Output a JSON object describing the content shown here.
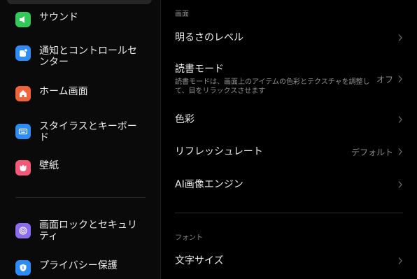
{
  "sidebar": {
    "items": [
      {
        "label": "サウンド",
        "icon": "sound-icon",
        "color": "#34c759"
      },
      {
        "label": "通知とコントロールセンター",
        "icon": "notification-icon",
        "color": "#2f8bf5"
      },
      {
        "label": "ホーム画面",
        "icon": "home-icon",
        "color": "#f0643c"
      },
      {
        "label": "スタイラスとキーボード",
        "icon": "keyboard-icon",
        "color": "#2f8bf5"
      },
      {
        "label": "壁紙",
        "icon": "wallpaper-icon",
        "color": "#f05a78"
      },
      {
        "label": "画面ロックとセキュリティ",
        "icon": "fingerprint-icon",
        "color": "#8a6cf0"
      },
      {
        "label": "プライバシー保護",
        "icon": "privacy-icon",
        "color": "#2f8bf5"
      }
    ]
  },
  "main": {
    "sections": {
      "display": "画面",
      "font": "フォント"
    },
    "rows": {
      "brightness": {
        "title": "明るさのレベル"
      },
      "reading": {
        "title": "読書モード",
        "desc": "読書モードは、画面上のアイテムの色彩とテクスチャを調整して、目をリラックスさせます",
        "value": "オフ"
      },
      "color": {
        "title": "色彩"
      },
      "refresh": {
        "title": "リフレッシュレート",
        "value": "デフォルト"
      },
      "ai_engine": {
        "title": "AI画像エンジン"
      },
      "text_size": {
        "title": "文字サイズ"
      }
    }
  }
}
